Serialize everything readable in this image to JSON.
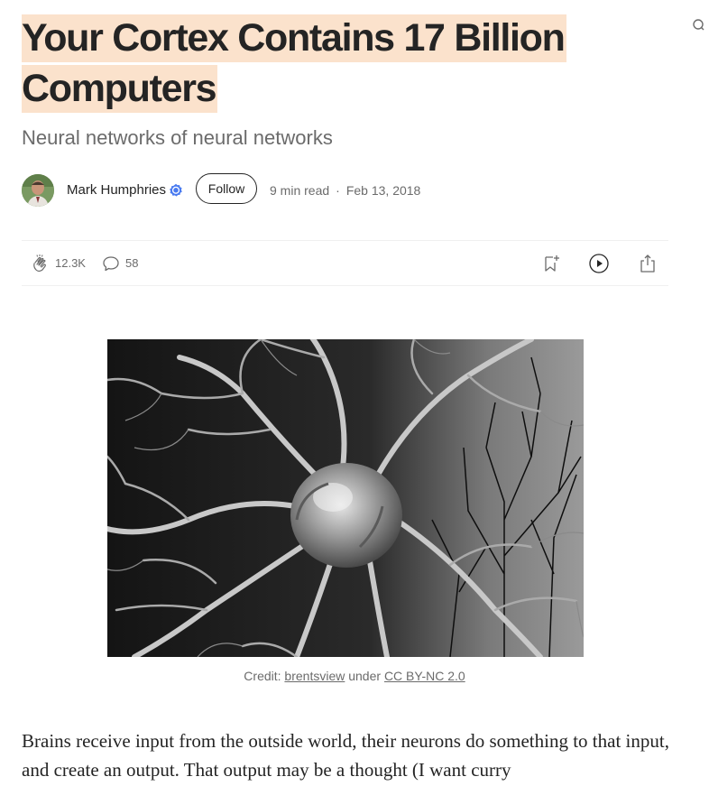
{
  "article": {
    "title": "Your Cortex Contains 17 Billion Computers",
    "subtitle": "Neural networks of neural networks"
  },
  "author": {
    "name": "Mark Humphries",
    "follow_label": "Follow",
    "read_time": "9 min read",
    "separator": "·",
    "date": "Feb 13, 2018"
  },
  "actions": {
    "claps": "12.3K",
    "responses": "58"
  },
  "figure": {
    "caption_prefix": "Credit: ",
    "caption_link1": "brentsview",
    "caption_mid": " under ",
    "caption_link2": "CC BY-NC 2.0"
  },
  "body": {
    "paragraph1": "Brains receive input from the outside world, their neurons do something to that input, and create an output. That output may be a thought (I want curry"
  },
  "colors": {
    "highlight": "#fbe2cc",
    "text": "#242424",
    "muted": "#6b6b6b",
    "verified": "#4a7bf0"
  },
  "icons": [
    "search-icon",
    "verified-badge-icon",
    "clap-icon",
    "comment-icon",
    "bookmark-add-icon",
    "play-icon",
    "share-icon"
  ]
}
